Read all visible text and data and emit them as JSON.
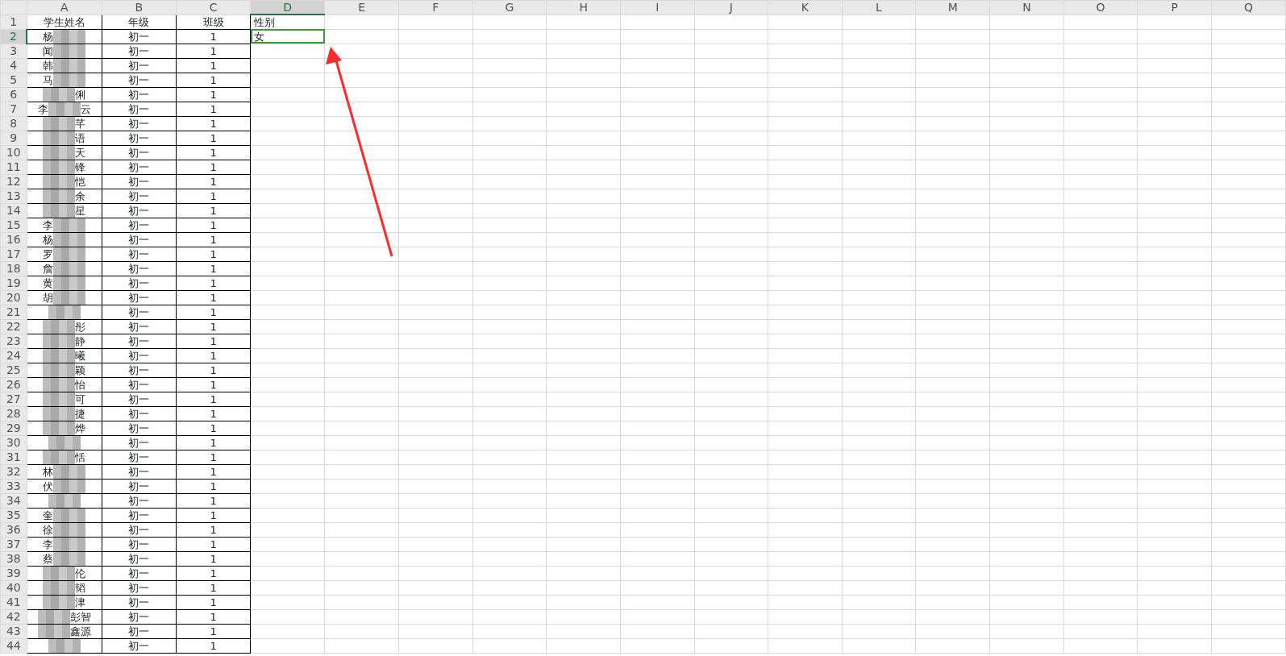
{
  "columns": [
    {
      "label": "A",
      "selected": false
    },
    {
      "label": "B",
      "selected": false
    },
    {
      "label": "C",
      "selected": false
    },
    {
      "label": "D",
      "selected": true
    },
    {
      "label": "E",
      "selected": false
    },
    {
      "label": "F",
      "selected": false
    },
    {
      "label": "G",
      "selected": false
    },
    {
      "label": "H",
      "selected": false
    },
    {
      "label": "I",
      "selected": false
    },
    {
      "label": "J",
      "selected": false
    },
    {
      "label": "K",
      "selected": false
    },
    {
      "label": "L",
      "selected": false
    },
    {
      "label": "M",
      "selected": false
    },
    {
      "label": "N",
      "selected": false
    },
    {
      "label": "O",
      "selected": false
    },
    {
      "label": "P",
      "selected": false
    },
    {
      "label": "Q",
      "selected": false
    }
  ],
  "header_row": {
    "number": "1",
    "selected": false,
    "cells": [
      "学生姓名",
      "年级",
      "班级",
      "性别"
    ]
  },
  "rows": [
    {
      "number": "2",
      "selected": true,
      "name_left": "杨",
      "grade": "初一",
      "class": "1",
      "gender": "女",
      "gender_selected": true
    },
    {
      "number": "3",
      "selected": false,
      "name_left": "闻",
      "grade": "初一",
      "class": "1"
    },
    {
      "number": "4",
      "selected": false,
      "name_left": "韩",
      "grade": "初一",
      "class": "1"
    },
    {
      "number": "5",
      "selected": false,
      "name_left": "马",
      "grade": "初一",
      "class": "1"
    },
    {
      "number": "6",
      "selected": false,
      "name_right": "俐",
      "grade": "初一",
      "class": "1"
    },
    {
      "number": "7",
      "selected": false,
      "name_left": "李",
      "name_right": "云",
      "grade": "初一",
      "class": "1"
    },
    {
      "number": "8",
      "selected": false,
      "name_right": "芊",
      "grade": "初一",
      "class": "1"
    },
    {
      "number": "9",
      "selected": false,
      "name_right": "语",
      "grade": "初一",
      "class": "1"
    },
    {
      "number": "10",
      "selected": false,
      "name_right": "天",
      "grade": "初一",
      "class": "1"
    },
    {
      "number": "11",
      "selected": false,
      "name_right": "锋",
      "grade": "初一",
      "class": "1"
    },
    {
      "number": "12",
      "selected": false,
      "name_right": "恺",
      "grade": "初一",
      "class": "1"
    },
    {
      "number": "13",
      "selected": false,
      "name_right": "余",
      "grade": "初一",
      "class": "1"
    },
    {
      "number": "14",
      "selected": false,
      "name_right": "星",
      "grade": "初一",
      "class": "1"
    },
    {
      "number": "15",
      "selected": false,
      "name_left": "李",
      "grade": "初一",
      "class": "1"
    },
    {
      "number": "16",
      "selected": false,
      "name_left": "杨",
      "grade": "初一",
      "class": "1"
    },
    {
      "number": "17",
      "selected": false,
      "name_left": "罗",
      "grade": "初一",
      "class": "1"
    },
    {
      "number": "18",
      "selected": false,
      "name_left": "詹",
      "grade": "初一",
      "class": "1"
    },
    {
      "number": "19",
      "selected": false,
      "name_left": "黄",
      "grade": "初一",
      "class": "1"
    },
    {
      "number": "20",
      "selected": false,
      "name_left": "胡",
      "grade": "初一",
      "class": "1"
    },
    {
      "number": "21",
      "selected": false,
      "grade": "初一",
      "class": "1"
    },
    {
      "number": "22",
      "selected": false,
      "name_right": "彤",
      "grade": "初一",
      "class": "1"
    },
    {
      "number": "23",
      "selected": false,
      "name_right": "静",
      "grade": "初一",
      "class": "1"
    },
    {
      "number": "24",
      "selected": false,
      "name_right": "曦",
      "grade": "初一",
      "class": "1"
    },
    {
      "number": "25",
      "selected": false,
      "name_right": "颖",
      "grade": "初一",
      "class": "1"
    },
    {
      "number": "26",
      "selected": false,
      "name_right": "怡",
      "grade": "初一",
      "class": "1"
    },
    {
      "number": "27",
      "selected": false,
      "name_right": "可",
      "grade": "初一",
      "class": "1"
    },
    {
      "number": "28",
      "selected": false,
      "name_right": "捷",
      "grade": "初一",
      "class": "1"
    },
    {
      "number": "29",
      "selected": false,
      "name_right": "烨",
      "grade": "初一",
      "class": "1"
    },
    {
      "number": "30",
      "selected": false,
      "grade": "初一",
      "class": "1"
    },
    {
      "number": "31",
      "selected": false,
      "name_right": "恬",
      "grade": "初一",
      "class": "1"
    },
    {
      "number": "32",
      "selected": false,
      "name_left": "林",
      "grade": "初一",
      "class": "1"
    },
    {
      "number": "33",
      "selected": false,
      "name_left": "伏",
      "grade": "初一",
      "class": "1"
    },
    {
      "number": "34",
      "selected": false,
      "grade": "初一",
      "class": "1"
    },
    {
      "number": "35",
      "selected": false,
      "name_left": "奎",
      "grade": "初一",
      "class": "1"
    },
    {
      "number": "36",
      "selected": false,
      "name_left": "徐",
      "grade": "初一",
      "class": "1"
    },
    {
      "number": "37",
      "selected": false,
      "name_left": "李",
      "grade": "初一",
      "class": "1"
    },
    {
      "number": "38",
      "selected": false,
      "name_left": "蔡",
      "grade": "初一",
      "class": "1"
    },
    {
      "number": "39",
      "selected": false,
      "name_right": "伦",
      "grade": "初一",
      "class": "1"
    },
    {
      "number": "40",
      "selected": false,
      "name_right": "韬",
      "grade": "初一",
      "class": "1"
    },
    {
      "number": "41",
      "selected": false,
      "name_right": "津",
      "grade": "初一",
      "class": "1"
    },
    {
      "number": "42",
      "selected": false,
      "name_right": "彭智",
      "grade": "初一",
      "class": "1"
    },
    {
      "number": "43",
      "selected": false,
      "name_right": "鑫源",
      "grade": "初一",
      "class": "1"
    },
    {
      "number": "44",
      "selected": false,
      "grade": "初一",
      "class": "1"
    }
  ]
}
